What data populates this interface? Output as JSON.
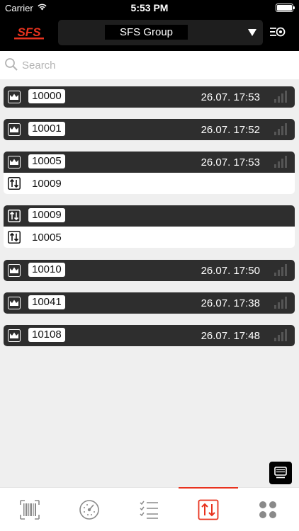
{
  "status_bar": {
    "carrier": "Carrier",
    "time": "5:53 PM"
  },
  "header": {
    "logo_text": "SFS",
    "company": "SFS Group"
  },
  "search": {
    "placeholder": "Search"
  },
  "colors": {
    "accent": "#e8321e",
    "header_bg": "#000000",
    "row_dark": "#2e2e2e",
    "background": "#efefef"
  },
  "list": [
    {
      "icon": "crown-icon",
      "number": "10000",
      "time": "26.07. 17:53"
    },
    {
      "icon": "crown-icon",
      "number": "10001",
      "time": "26.07. 17:52"
    },
    {
      "icon": "crown-icon",
      "number": "10005",
      "time": "26.07. 17:53",
      "child": {
        "icon": "transfer-icon",
        "number": "10009"
      }
    },
    {
      "icon": "transfer-icon",
      "number": "10009",
      "child": {
        "icon": "transfer-icon",
        "number": "10005"
      }
    },
    {
      "icon": "crown-icon",
      "number": "10010",
      "time": "26.07. 17:50"
    },
    {
      "icon": "crown-icon",
      "number": "10041",
      "time": "26.07. 17:38"
    },
    {
      "icon": "crown-icon",
      "number": "10108",
      "time": "26.07. 17:48"
    }
  ],
  "tabs": [
    {
      "name": "barcode",
      "icon": "barcode-icon",
      "active": false
    },
    {
      "name": "dashboard",
      "icon": "gauge-icon",
      "active": false
    },
    {
      "name": "checklist",
      "icon": "checklist-icon",
      "active": false
    },
    {
      "name": "transfer",
      "icon": "transfer-icon",
      "active": true
    },
    {
      "name": "more",
      "icon": "grid-dots-icon",
      "active": false
    }
  ]
}
